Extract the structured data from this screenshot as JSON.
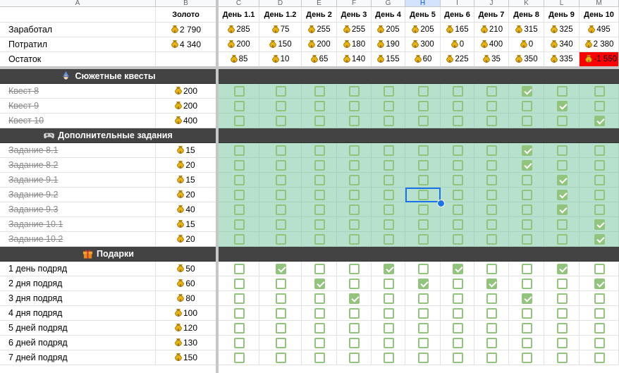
{
  "column_letters": [
    "A",
    "B",
    "C",
    "D",
    "E",
    "F",
    "G",
    "H",
    "I",
    "J",
    "K",
    "L",
    "M"
  ],
  "selected_column": "H",
  "header": {
    "gold_label": "Золото",
    "days": [
      "День 1.1",
      "День 1.2",
      "День 2",
      "День 3",
      "День 4",
      "День 5",
      "День 6",
      "День 7",
      "День 8",
      "День 9",
      "День 10"
    ]
  },
  "summary": [
    {
      "label": "Заработал",
      "total": "2 790",
      "days": [
        "285",
        "75",
        "255",
        "255",
        "205",
        "205",
        "165",
        "210",
        "315",
        "325",
        "495"
      ]
    },
    {
      "label": "Потратил",
      "total": "4 340",
      "days": [
        "200",
        "150",
        "200",
        "180",
        "190",
        "300",
        "0",
        "400",
        "0",
        "340",
        "2 380"
      ]
    },
    {
      "label": "Остаток",
      "total": "",
      "days": [
        "85",
        "10",
        "65",
        "140",
        "155",
        "60",
        "225",
        "35",
        "350",
        "335",
        "-1 550"
      ]
    }
  ],
  "sections": [
    {
      "title": "Сюжетные квесты",
      "icon": "wizard-icon",
      "rows": [
        {
          "label": "Квест 8",
          "gold": "200",
          "done": true,
          "checks": [
            false,
            false,
            false,
            false,
            false,
            false,
            false,
            false,
            true,
            false,
            false
          ]
        },
        {
          "label": "Квест 9",
          "gold": "200",
          "done": true,
          "checks": [
            false,
            false,
            false,
            false,
            false,
            false,
            false,
            false,
            false,
            true,
            false
          ]
        },
        {
          "label": "Квест 10",
          "gold": "400",
          "done": true,
          "checks": [
            false,
            false,
            false,
            false,
            false,
            false,
            false,
            false,
            false,
            false,
            true
          ]
        }
      ]
    },
    {
      "title": "Дополнительные задания",
      "icon": "gamepad-icon",
      "rows": [
        {
          "label": "Задание 8.1",
          "gold": "15",
          "done": true,
          "checks": [
            false,
            false,
            false,
            false,
            false,
            false,
            false,
            false,
            true,
            false,
            false
          ]
        },
        {
          "label": "Задание 8.2",
          "gold": "20",
          "done": true,
          "checks": [
            false,
            false,
            false,
            false,
            false,
            false,
            false,
            false,
            true,
            false,
            false
          ]
        },
        {
          "label": "Задание 9.1",
          "gold": "15",
          "done": true,
          "checks": [
            false,
            false,
            false,
            false,
            false,
            false,
            false,
            false,
            false,
            true,
            false
          ]
        },
        {
          "label": "Задание 9.2",
          "gold": "20",
          "done": true,
          "checks": [
            false,
            false,
            false,
            false,
            false,
            false,
            false,
            false,
            false,
            true,
            false
          ]
        },
        {
          "label": "Задание 9.3",
          "gold": "40",
          "done": true,
          "checks": [
            false,
            false,
            false,
            false,
            false,
            false,
            false,
            false,
            false,
            true,
            false
          ]
        },
        {
          "label": "Задание 10.1",
          "gold": "15",
          "done": true,
          "checks": [
            false,
            false,
            false,
            false,
            false,
            false,
            false,
            false,
            false,
            false,
            true
          ]
        },
        {
          "label": "Задание 10.2",
          "gold": "20",
          "done": true,
          "checks": [
            false,
            false,
            false,
            false,
            false,
            false,
            false,
            false,
            false,
            false,
            true
          ]
        }
      ]
    },
    {
      "title": "Подарки",
      "icon": "gift-icon",
      "rows": [
        {
          "label": "1 день подряд",
          "gold": "50",
          "done": false,
          "checks": [
            false,
            true,
            false,
            false,
            true,
            false,
            true,
            false,
            false,
            true,
            false
          ]
        },
        {
          "label": "2 дня подряд",
          "gold": "60",
          "done": false,
          "checks": [
            false,
            false,
            true,
            false,
            false,
            true,
            false,
            true,
            false,
            false,
            true
          ]
        },
        {
          "label": "3 дня подряд",
          "gold": "80",
          "done": false,
          "checks": [
            false,
            false,
            false,
            true,
            false,
            false,
            false,
            false,
            true,
            false,
            false
          ]
        },
        {
          "label": "4 дня подряд",
          "gold": "100",
          "done": false,
          "checks": [
            false,
            false,
            false,
            false,
            false,
            false,
            false,
            false,
            false,
            false,
            false
          ]
        },
        {
          "label": "5 дней подряд",
          "gold": "120",
          "done": false,
          "checks": [
            false,
            false,
            false,
            false,
            false,
            false,
            false,
            false,
            false,
            false,
            false
          ]
        },
        {
          "label": "6 дней подряд",
          "gold": "130",
          "done": false,
          "checks": [
            false,
            false,
            false,
            false,
            false,
            false,
            false,
            false,
            false,
            false,
            false
          ]
        },
        {
          "label": "7 дней подряд",
          "gold": "150",
          "done": false,
          "checks": [
            false,
            false,
            false,
            false,
            false,
            false,
            false,
            false,
            false,
            false,
            false
          ]
        }
      ]
    }
  ],
  "colors": {
    "accent": "#1a73e8",
    "checkbox": "#93c47d",
    "done_fill": "#b7e1cd",
    "section_bg": "#434343",
    "negative": "#ff0000"
  }
}
